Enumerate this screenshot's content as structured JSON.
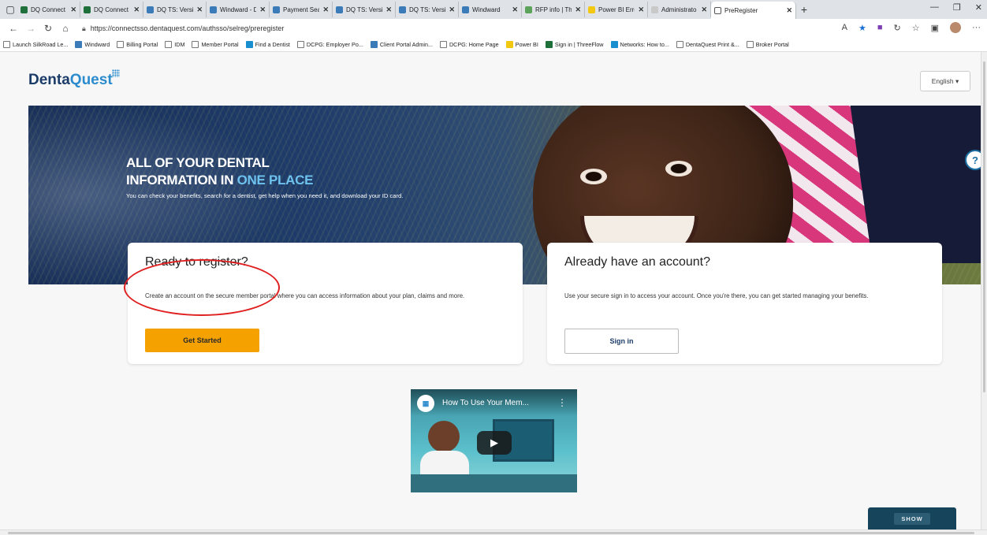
{
  "browser": {
    "tabs": [
      {
        "label": "DQ Connect",
        "color": "#1f6f3b"
      },
      {
        "label": "DQ Connect",
        "color": "#1f6f3b"
      },
      {
        "label": "DQ TS: Versio",
        "color": "#3b7bb8"
      },
      {
        "label": "Windward - D",
        "color": "#3b7bb8"
      },
      {
        "label": "Payment Sear",
        "color": "#3b7bb8"
      },
      {
        "label": "DQ TS: Versio",
        "color": "#3b7bb8"
      },
      {
        "label": "DQ TS: Versio",
        "color": "#3b7bb8"
      },
      {
        "label": "Windward",
        "color": "#3b7bb8"
      },
      {
        "label": "RFP info | Th",
        "color": "#5ba35b"
      },
      {
        "label": "Power BI Erro",
        "color": "#f2c811"
      },
      {
        "label": "Administrato",
        "color": "#c9c9c9"
      },
      {
        "label": "PreRegister",
        "color": "#ffffff"
      }
    ],
    "url": "https://connectsso.dentaquest.com/authsso/selreg/preregister",
    "bookmarks": [
      {
        "label": "Launch SilkRoad Le..."
      },
      {
        "label": "Windward"
      },
      {
        "label": "Billing Portal"
      },
      {
        "label": "IDM"
      },
      {
        "label": "Member Portal"
      },
      {
        "label": "Find a Dentist"
      },
      {
        "label": "DCPG: Employer Po..."
      },
      {
        "label": "Client Portal Admin..."
      },
      {
        "label": "DCPG: Home Page"
      },
      {
        "label": "Power BI"
      },
      {
        "label": "Sign in | ThreeFlow"
      },
      {
        "label": "Networks: How to..."
      },
      {
        "label": "DentaQuest Print &..."
      },
      {
        "label": "Broker Portal"
      }
    ]
  },
  "page": {
    "logo": {
      "part1": "Denta",
      "part2": "Quest"
    },
    "language": "English ▾",
    "hero": {
      "line1": "ALL OF YOUR DENTAL",
      "line2_plain": "INFORMATION IN ",
      "line2_accent": "ONE PLACE",
      "subtitle": "You can check your benefits, search for a dentist, get help when you need it, and download your ID card."
    },
    "register_card": {
      "title": "Ready to register?",
      "body": "Create an account on the secure member portal where you can access information about your plan, claims and more.",
      "button": "Get Started"
    },
    "signin_card": {
      "title": "Already have an account?",
      "body": "Use your secure sign in to access your account. Once you're there, you can get started managing your benefits.",
      "button": "Sign in"
    },
    "video": {
      "title": "How To Use Your Mem..."
    },
    "show_button": "SHOW"
  },
  "colors": {
    "accent_orange": "#f5a100",
    "brand_navy": "#1b3c68",
    "brand_blue": "#2c8bcd",
    "highlight_red": "#e02020"
  }
}
